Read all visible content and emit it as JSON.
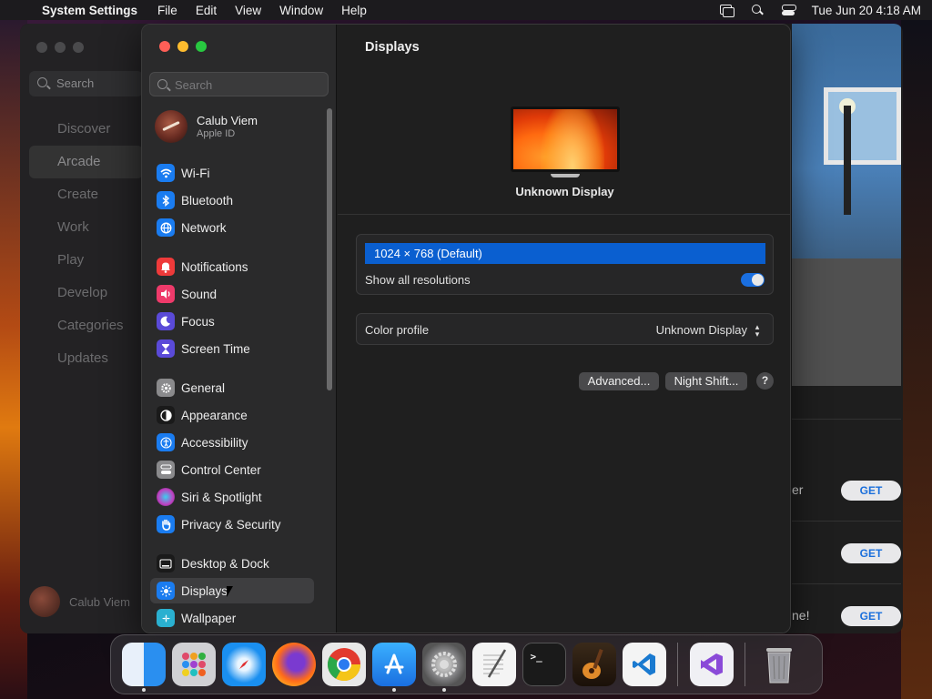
{
  "menubar": {
    "app": "System Settings",
    "menus": [
      "File",
      "Edit",
      "View",
      "Window",
      "Help"
    ],
    "clock": "Tue Jun 20  4:18 AM"
  },
  "bg_app": {
    "search": "Search",
    "nav": [
      "Discover",
      "Arcade",
      "Create",
      "Work",
      "Play",
      "Develop",
      "Categories",
      "Updates"
    ],
    "user": "Calub Viem",
    "items": [
      {
        "text": "er",
        "button": "GET"
      },
      {
        "text": "",
        "button": "GET"
      },
      {
        "text": "ne!",
        "button": "GET"
      }
    ]
  },
  "sidebar": {
    "search_placeholder": "Search",
    "profile": {
      "name": "Calub Viem",
      "sub": "Apple ID"
    },
    "items": [
      {
        "label": "Wi-Fi",
        "icon": "wifi-icon",
        "color": "#1a7cf0"
      },
      {
        "label": "Bluetooth",
        "icon": "bluetooth-icon",
        "color": "#1a7cf0"
      },
      {
        "label": "Network",
        "icon": "globe-icon",
        "color": "#1a7cf0"
      },
      {
        "label": "Notifications",
        "icon": "bell-icon",
        "color": "#ee3a3a"
      },
      {
        "label": "Sound",
        "icon": "speaker-icon",
        "color": "#ee3a6a"
      },
      {
        "label": "Focus",
        "icon": "moon-icon",
        "color": "#5a4ad8"
      },
      {
        "label": "Screen Time",
        "icon": "hourglass-icon",
        "color": "#5a4ad8"
      },
      {
        "label": "General",
        "icon": "gear-icon",
        "color": "#8a8a8c"
      },
      {
        "label": "Appearance",
        "icon": "appearance-icon",
        "color": "#1a1a1a"
      },
      {
        "label": "Accessibility",
        "icon": "accessibility-icon",
        "color": "#1a7cf0"
      },
      {
        "label": "Control Center",
        "icon": "control-center-icon",
        "color": "#8a8a8c"
      },
      {
        "label": "Siri & Spotlight",
        "icon": "siri-icon",
        "color": "#c040c0"
      },
      {
        "label": "Privacy & Security",
        "icon": "hand-icon",
        "color": "#1a7cf0"
      },
      {
        "label": "Desktop & Dock",
        "icon": "dock-icon",
        "color": "#1a1a1a"
      },
      {
        "label": "Displays",
        "icon": "sun-icon",
        "color": "#1a7cf0"
      },
      {
        "label": "Wallpaper",
        "icon": "wallpaper-icon",
        "color": "#2ab0d0"
      }
    ]
  },
  "detail": {
    "title": "Displays",
    "display_name": "Unknown Display",
    "resolution": "1024 × 768 (Default)",
    "show_all_label": "Show all resolutions",
    "show_all_on": true,
    "color_profile_label": "Color profile",
    "color_profile_value": "Unknown Display",
    "advanced_button": "Advanced...",
    "night_shift_button": "Night Shift...",
    "help_button": "?"
  },
  "dock": {
    "apps": [
      {
        "name": "finder-icon",
        "color": "#2a8ff0"
      },
      {
        "name": "launchpad-icon",
        "color": "#d0d0d4"
      },
      {
        "name": "safari-icon",
        "color": "#1a8ff0"
      },
      {
        "name": "firefox-icon",
        "color": "#ff7a1a"
      },
      {
        "name": "chrome-icon",
        "color": "#e8e8e8"
      },
      {
        "name": "app-store-icon",
        "color": "#1a7cf0"
      },
      {
        "name": "system-settings-icon",
        "color": "#8a8a8c"
      },
      {
        "name": "textedit-icon",
        "color": "#f0f0f0"
      },
      {
        "name": "terminal-icon",
        "color": "#1a1a1a"
      },
      {
        "name": "garageband-icon",
        "color": "#e08a2a"
      },
      {
        "name": "vscode-icon",
        "color": "#2a8ff0"
      },
      {
        "name": "visual-studio-icon",
        "color": "#f0f0f4"
      },
      {
        "name": "trash-icon",
        "color": "#9a9aa0"
      }
    ]
  }
}
